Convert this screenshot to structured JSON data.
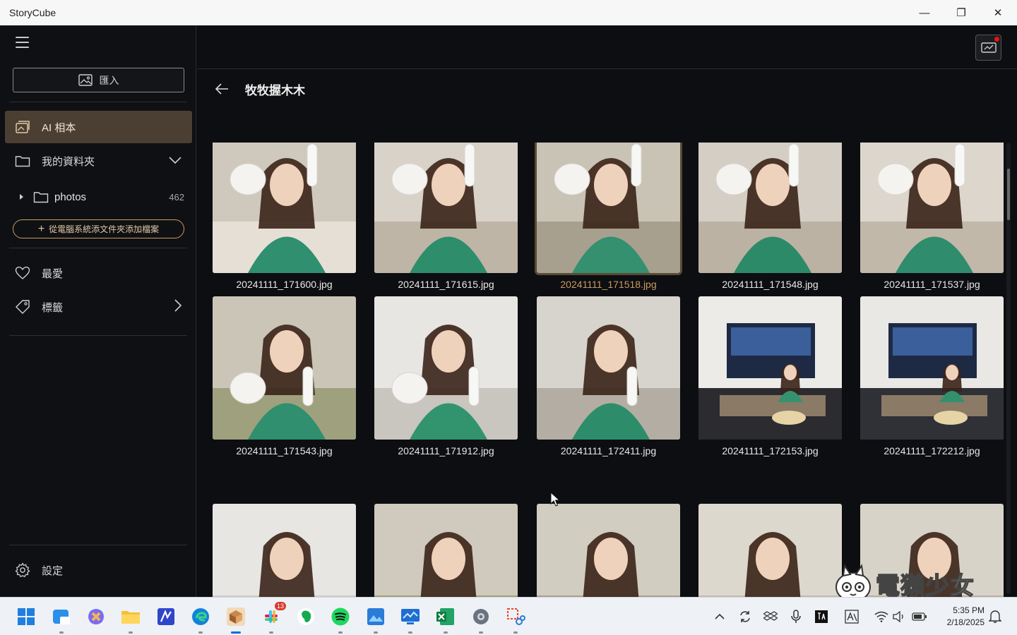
{
  "window": {
    "title": "StoryCube",
    "minimize": "—",
    "restore": "❐",
    "close": "✕"
  },
  "sidebar": {
    "import_label": "匯入",
    "items": [
      {
        "label": "AI 相本",
        "icon": "album-icon",
        "active": true
      },
      {
        "label": "我的資料夾",
        "icon": "folder-icon",
        "trail": "chevron-down-icon"
      }
    ],
    "folder": {
      "label": "photos",
      "count": "462"
    },
    "add_folder_label": "從電腦系統添文件夾添加檔案",
    "items2": [
      {
        "label": "最愛",
        "icon": "heart-icon"
      },
      {
        "label": "標籤",
        "icon": "tag-icon",
        "trail": "chevron-right-icon"
      }
    ],
    "settings_label": "設定"
  },
  "main": {
    "folder_title": "牧牧握木木",
    "photos": [
      {
        "name": "20241111_171600.jpg"
      },
      {
        "name": "20241111_171615.jpg"
      },
      {
        "name": "20241111_171518.jpg",
        "selected": true
      },
      {
        "name": "20241111_171548.jpg"
      },
      {
        "name": "20241111_171537.jpg"
      },
      {
        "name": "20241111_171543.jpg"
      },
      {
        "name": "20241111_171912.jpg"
      },
      {
        "name": "20241111_172411.jpg"
      },
      {
        "name": "20241111_172153.jpg"
      },
      {
        "name": "20241111_172212.jpg"
      },
      {
        "name": ""
      },
      {
        "name": ""
      },
      {
        "name": ""
      },
      {
        "name": ""
      },
      {
        "name": ""
      }
    ]
  },
  "taskbar": {
    "slack_badge": "13",
    "time": "5:35 PM",
    "date": "2/18/2025"
  },
  "watermark": {
    "text": "電獺少女"
  },
  "colors": {
    "accent": "#c99a5f",
    "active_bg": "#4a3f32",
    "background": "#0d0e11"
  }
}
